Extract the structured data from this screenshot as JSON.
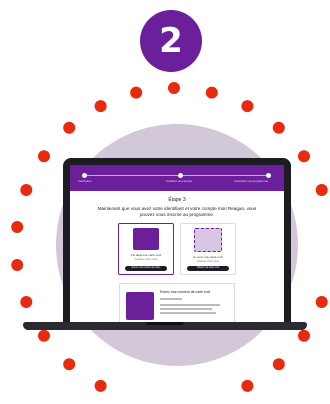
{
  "step_badge": {
    "number": "2"
  },
  "screen": {
    "progress": {
      "labels": [
        "Inscription",
        "Création du compte",
        "Inscription au programme"
      ]
    },
    "etape_title": "Étape 3",
    "instruction": "Maintenant que vous avez votre identifiant et votre compte moi! Reagan, vous pouvez vous inscrire au programme.",
    "cards": [
      {
        "title": "J'ai déjà une carte moi!",
        "subtitle": "Associez votre carte",
        "button": "Entrer mon numéro de carte"
      },
      {
        "title": "Je veux une carte moi!",
        "subtitle": "Obtenez votre carte",
        "button": "Obtenir ma carte moi!"
      }
    ],
    "info_card": {
      "title": "Entrez mon numéro de carte moi!"
    }
  },
  "colors": {
    "purple": "#6b1f9a",
    "dot_red": "#e82a0f",
    "circle": "#d3c8da",
    "laptop": "#1c1c23"
  },
  "icons": [
    "laptop-icon",
    "card-icon"
  ]
}
